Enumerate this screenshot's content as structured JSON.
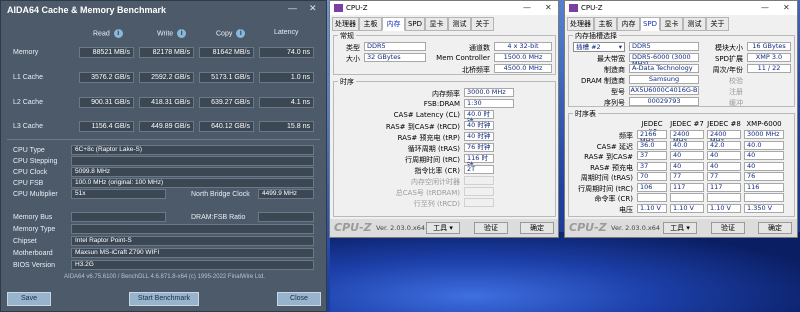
{
  "aida": {
    "title": "AIDA64 Cache & Memory Benchmark",
    "columns": [
      "Read",
      "Write",
      "Copy",
      "Latency"
    ],
    "rows": [
      {
        "label": "Memory",
        "read": "88521 MB/s",
        "write": "82178 MB/s",
        "copy": "81642 MB/s",
        "latency": "74.0 ns"
      },
      {
        "label": "L1 Cache",
        "read": "3576.2 GB/s",
        "write": "2592.2 GB/s",
        "copy": "5173.1 GB/s",
        "latency": "1.0 ns"
      },
      {
        "label": "L2 Cache",
        "read": "900.31 GB/s",
        "write": "418.31 GB/s",
        "copy": "639.27 GB/s",
        "latency": "4.1 ns"
      },
      {
        "label": "L3 Cache",
        "read": "1156.4 GB/s",
        "write": "449.89 GB/s",
        "copy": "640.12 GB/s",
        "latency": "15.8 ns"
      }
    ],
    "info": {
      "cpu_type_label": "CPU Type",
      "cpu_type": "6C+8c   (Raptor Lake-S)",
      "cpu_stepping_label": "CPU Stepping",
      "cpu_stepping": "",
      "cpu_clock_label": "CPU Clock",
      "cpu_clock": "5099.8 MHz",
      "cpu_fsb_label": "CPU FSB",
      "cpu_fsb": "100.0 MHz   (original: 100 MHz)",
      "cpu_mult_label": "CPU Multiplier",
      "cpu_mult": "51x",
      "nb_clock_label": "North Bridge Clock",
      "nb_clock": "4499.9 MHz",
      "mem_bus_label": "Memory Bus",
      "mem_bus": "",
      "dram_fsb_label": "DRAM:FSB Ratio",
      "dram_fsb": "",
      "mem_type_label": "Memory Type",
      "mem_type": "",
      "chipset_label": "Chipset",
      "chipset": "Intel Raptor Point-S",
      "mobo_label": "Motherboard",
      "mobo": "Maxsun MS-iCraft Z790 WIFI",
      "bios_label": "BIOS Version",
      "bios": "H3.2G"
    },
    "footer": "AIDA64 v6.75.6100 / BenchDLL 4.6.871.8-x64  (c) 1995-2022 FinalWire Ltd.",
    "buttons": {
      "save": "Save",
      "start": "Start Benchmark",
      "close": "Close"
    }
  },
  "cpuz1": {
    "title": "CPU-Z",
    "tabs": [
      "处理器",
      "主板",
      "内存",
      "SPD",
      "显卡",
      "测试",
      "关于"
    ],
    "active_tab": "内存",
    "general": {
      "group": "常规",
      "type_label": "类型",
      "type": "DDR5",
      "size_label": "大小",
      "size": "32 GBytes",
      "channel_label": "通道数",
      "channel": "4 x 32-bit",
      "memctrl_label": "Mem Controller",
      "memctrl": "1500.0 MHz",
      "nb_label": "北桥频率",
      "nb": "4500.0 MHz"
    },
    "timing": {
      "group": "时序",
      "rows": [
        {
          "label": "内存频率",
          "value": "3000.0 MHz"
        },
        {
          "label": "FSB:DRAM",
          "value": "1:30"
        },
        {
          "label": "CAS# Latency (CL)",
          "value": "40.0 时钟"
        },
        {
          "label": "RAS# 到CAS# (tRCD)",
          "value": "40 时钟"
        },
        {
          "label": "RAS# 预充电 (tRP)",
          "value": "40 时钟"
        },
        {
          "label": "循环周期 (tRAS)",
          "value": "76 时钟"
        },
        {
          "label": "行周期时间 (tRC)",
          "value": "116 时钟"
        },
        {
          "label": "指令比率 (CR)",
          "value": "2T"
        }
      ],
      "dim_rows": [
        "内存空闲计时器",
        "总CAS号 (tRDRAM)",
        "行至列 (tRCD)"
      ]
    },
    "version": "Ver. 2.03.0.x64",
    "tools": "工具",
    "validate": "验证",
    "ok": "确定"
  },
  "cpuz2": {
    "title": "CPU-Z",
    "tabs": [
      "处理器",
      "主板",
      "内存",
      "SPD",
      "显卡",
      "测试",
      "关于"
    ],
    "active_tab": "SPD",
    "slot_group": "内存插槽选择",
    "slot": "插槽 #2",
    "module_type": "DDR5",
    "module_size_label": "模块大小",
    "module_size": "16 GBytes",
    "max_bw_label": "最大带宽",
    "max_bw": "DDR5-6000 (3000 MHz)",
    "spd_ext_label": "SPD扩展",
    "spd_ext": "XMP 3.0",
    "maker_label": "制造商",
    "maker": "A-Data Technology",
    "week_label": "周次/年份",
    "week": "11 / 22",
    "dram_maker_label": "DRAM 制造商",
    "dram_maker": "Samsung",
    "model_label": "型号",
    "model": "AX5U6000C4016G-B",
    "serial_label": "序列号",
    "serial": "00029793",
    "ecc_label": "校验",
    "register_label": "注册",
    "buffered_label": "缓冲",
    "spd_label": "SPD",
    "timing_group": "时序表",
    "timing_headers": [
      "JEDEC #6",
      "JEDEC #7",
      "JEDEC #8",
      "XMP-6000"
    ],
    "timing_rows": [
      {
        "label": "频率",
        "values": [
          "2166 MHz",
          "2400 MHz",
          "2400 MHz",
          "3000 MHz"
        ]
      },
      {
        "label": "CAS# 延迟",
        "values": [
          "36.0",
          "40.0",
          "42.0",
          "40.0"
        ]
      },
      {
        "label": "RAS# 到CAS#",
        "values": [
          "37",
          "40",
          "40",
          "40"
        ]
      },
      {
        "label": "RAS# 预充电",
        "values": [
          "37",
          "40",
          "40",
          "40"
        ]
      },
      {
        "label": "周期时间 (tRAS)",
        "values": [
          "70",
          "77",
          "77",
          "76"
        ]
      },
      {
        "label": "行周期时间 (tRC)",
        "values": [
          "106",
          "117",
          "117",
          "116"
        ]
      },
      {
        "label": "命令率 (CR)",
        "values": [
          "",
          "",
          "",
          ""
        ]
      },
      {
        "label": "电压",
        "values": [
          "1.10 V",
          "1.10 V",
          "1.10 V",
          "1.350 V"
        ]
      }
    ],
    "version": "Ver. 2.03.0.x64",
    "tools": "工具",
    "validate": "验证",
    "ok": "确定"
  }
}
